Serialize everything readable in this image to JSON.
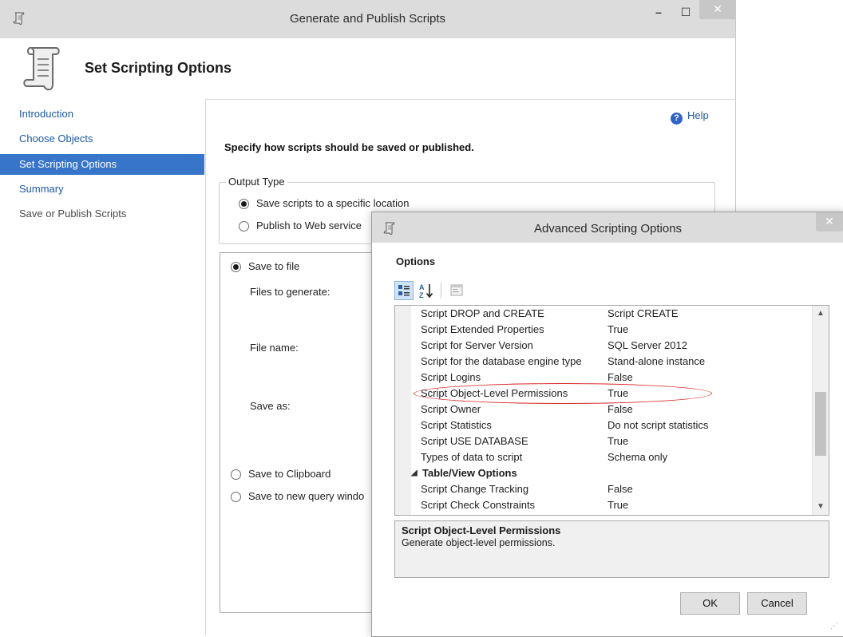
{
  "main_window": {
    "title": "Generate and Publish Scripts",
    "controls": {
      "minimize": "–",
      "maximize": "☐",
      "close": "✕"
    }
  },
  "header": {
    "title": "Set Scripting Options"
  },
  "sidebar": {
    "items": [
      {
        "label": "Introduction",
        "state": "link"
      },
      {
        "label": "Choose Objects",
        "state": "link"
      },
      {
        "label": "Set Scripting Options",
        "state": "active"
      },
      {
        "label": "Summary",
        "state": "link"
      },
      {
        "label": "Save or Publish Scripts",
        "state": "disabled"
      }
    ]
  },
  "content": {
    "help": "Help",
    "instruction": "Specify how scripts should be saved or published.",
    "output_type": {
      "legend": "Output Type",
      "save_location": "Save scripts to a specific location",
      "publish_web": "Publish to Web service"
    },
    "save": {
      "save_to_file": "Save to file",
      "files_to_generate": "Files to generate:",
      "file_name": "File name:",
      "save_as": "Save as:",
      "save_to_clipboard": "Save to Clipboard",
      "save_to_query_window": "Save to new query windo"
    }
  },
  "dialog": {
    "title": "Advanced Scripting Options",
    "close": "✕",
    "options_heading": "Options",
    "rows": [
      {
        "name": "Script DROP and CREATE",
        "value": "Script CREATE"
      },
      {
        "name": "Script Extended Properties",
        "value": "True"
      },
      {
        "name": "Script for Server Version",
        "value": "SQL Server 2012"
      },
      {
        "name": "Script for the database engine type",
        "value": "Stand-alone instance"
      },
      {
        "name": "Script Logins",
        "value": "False"
      },
      {
        "name": "Script Object-Level Permissions",
        "value": "True"
      },
      {
        "name": "Script Owner",
        "value": "False"
      },
      {
        "name": "Script Statistics",
        "value": "Do not script statistics"
      },
      {
        "name": "Script USE DATABASE",
        "value": "True"
      },
      {
        "name": "Types of data to script",
        "value": "Schema only"
      },
      {
        "name": "Table/View Options",
        "value": "",
        "category": true
      },
      {
        "name": "Script Change Tracking",
        "value": "False"
      },
      {
        "name": "Script Check Constraints",
        "value": "True"
      }
    ],
    "description": {
      "title": "Script Object-Level Permissions",
      "text": "Generate object-level permissions."
    },
    "buttons": {
      "ok": "OK",
      "cancel": "Cancel"
    }
  },
  "icons": {
    "title_icon": "scroll-icon",
    "help_icon": "help-icon",
    "categorized": "categorized-icon",
    "alphabetical": "sort-alpha-icon",
    "property_pages": "property-pages-icon"
  },
  "colors": {
    "accent": "#3675c9",
    "link": "#1c58a8",
    "highlight_oval": "#d92626"
  }
}
